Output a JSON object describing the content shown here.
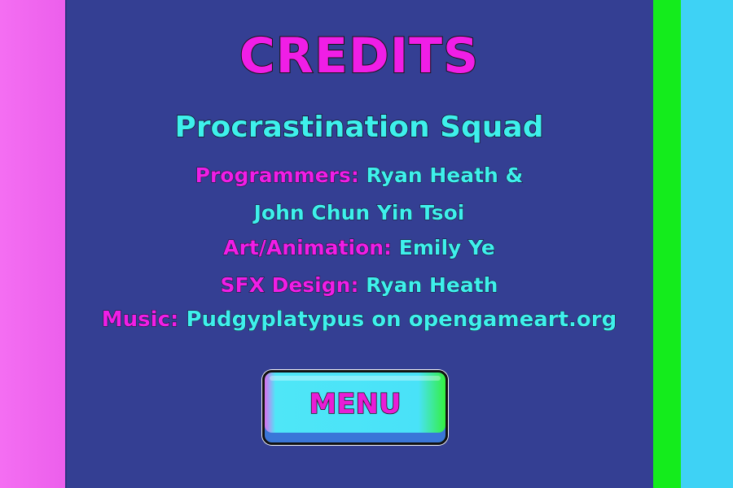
{
  "screen": {
    "title": "CREDITS",
    "team_name": "Procrastination Squad"
  },
  "credits": [
    {
      "role": "Programmers:",
      "name": "Ryan Heath &"
    },
    {
      "role": "",
      "name": "John Chun Yin Tsoi"
    },
    {
      "role": "Art/Animation:",
      "name": "Emily Ye"
    },
    {
      "role": "SFX Design:",
      "name": "Ryan Heath"
    },
    {
      "role": "Music:",
      "name": "Pudgyplatypus on opengameart.org"
    }
  ],
  "menu_button": {
    "label": "MENU"
  },
  "colors": {
    "panel": "#343f93",
    "left_strip": "#f06cf0",
    "right_green_strip": "#14ec1c",
    "right_cyan_strip": "#3ed2f5",
    "role_text": "#f01ee6",
    "name_text": "#3ef0ec"
  }
}
